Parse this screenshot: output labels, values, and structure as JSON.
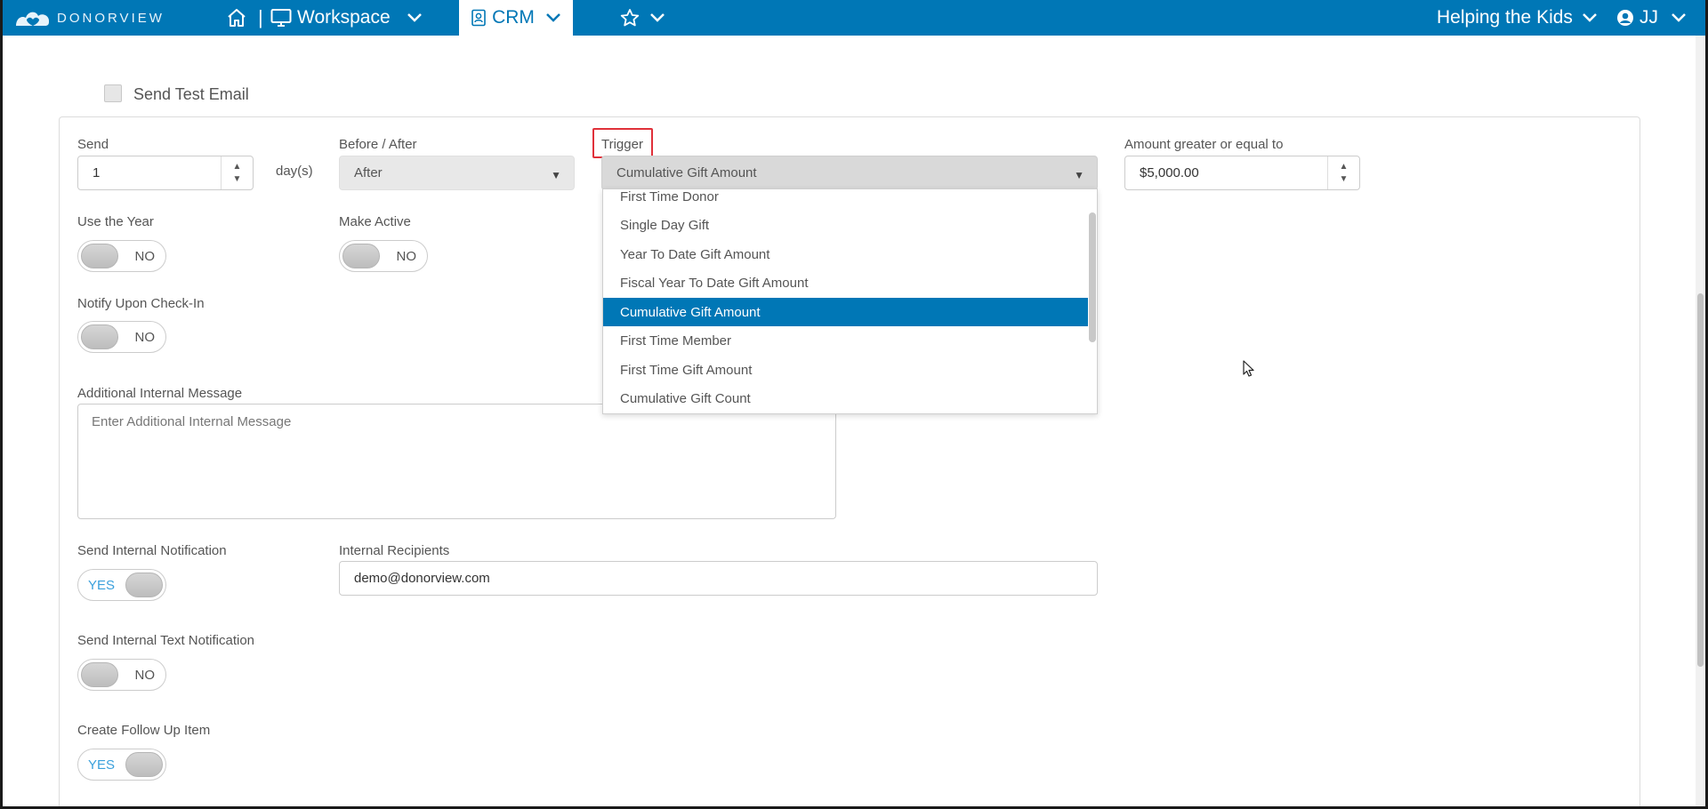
{
  "nav": {
    "logo_text": "DONORVIEW",
    "separator": "|",
    "workspace": "Workspace",
    "crm": "CRM",
    "org": "Helping the Kids",
    "user": "JJ"
  },
  "form": {
    "send_test_email": "Send Test Email",
    "send_label": "Send",
    "send_value": "1",
    "days_suffix": "day(s)",
    "before_after_label": "Before / After",
    "before_after_value": "After",
    "trigger_label": "Trigger",
    "trigger_value": "Cumulative Gift Amount",
    "amount_label": "Amount greater or equal to",
    "amount_value": "$5,000.00",
    "use_year_label": "Use the Year",
    "use_year_state": "NO",
    "make_active_label": "Make Active",
    "make_active_state": "NO",
    "notify_checkin_label": "Notify Upon Check-In",
    "notify_checkin_state": "NO",
    "additional_message_label": "Additional Internal Message",
    "additional_message_placeholder": "Enter Additional Internal Message",
    "send_internal_label": "Send Internal Notification",
    "send_internal_state": "YES",
    "internal_recipients_label": "Internal Recipients",
    "internal_recipients_value": "demo@donorview.com",
    "send_text_label": "Send Internal Text Notification",
    "send_text_state": "NO",
    "follow_up_label": "Create Follow Up Item",
    "follow_up_state": "YES"
  },
  "trigger_options": [
    "First Time Donor",
    "Single Day Gift",
    "Year To Date Gift Amount",
    "Fiscal Year To Date Gift Amount",
    "Cumulative Gift Amount",
    "First Time Member",
    "First Time Gift Amount",
    "Cumulative Gift Count"
  ],
  "trigger_selected": "Cumulative Gift Amount",
  "colors": {
    "brand": "#0077b6",
    "highlight_box": "#e0313a",
    "toggle_yes": "#3aa0dc"
  }
}
